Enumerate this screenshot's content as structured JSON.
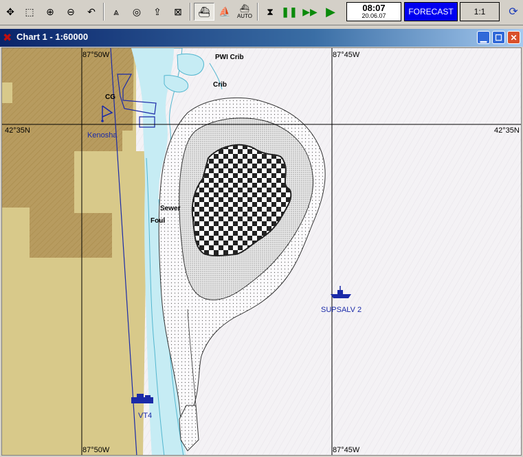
{
  "toolbar": {
    "tools": [
      "move-icon",
      "zoom-box-icon",
      "zoom-in-icon",
      "zoom-out-icon",
      "undo-icon",
      "compass-icon",
      "target-icon",
      "pickup-icon",
      "dump-icon",
      "ship-mode-icon",
      "ship-small-icon",
      "auto-icon",
      "step-icon",
      "pause-icon",
      "fast-forward-icon",
      "play-icon",
      "sync-icon"
    ],
    "auto_label": "AUTO",
    "time": "08:07",
    "date": "20.06.07",
    "forecast_label": "FORECAST",
    "scale_label": "1:1"
  },
  "window": {
    "title": "Chart 1 - 1:60000"
  },
  "map": {
    "longitude_labels": {
      "west": "87°50W",
      "east": "87°45W"
    },
    "latitude_label": "42°35N",
    "place_labels": {
      "pwi_crib": "PWI Crib",
      "crib": "Crib",
      "cg": "CG",
      "kenosha": "Kenosha",
      "sewer": "Sewer",
      "foul": "Foul"
    },
    "vessels": {
      "supsalv": "SUPSALV 2",
      "vt4": "VT4"
    },
    "colors": {
      "land": "#b79b5f",
      "land_light": "#d8c98a",
      "shallow_water": "#c6ecf4",
      "deep_water": "#f4f2f5",
      "vessel": "#1a2aa8",
      "labels_blue": "#1a2aa8"
    }
  }
}
